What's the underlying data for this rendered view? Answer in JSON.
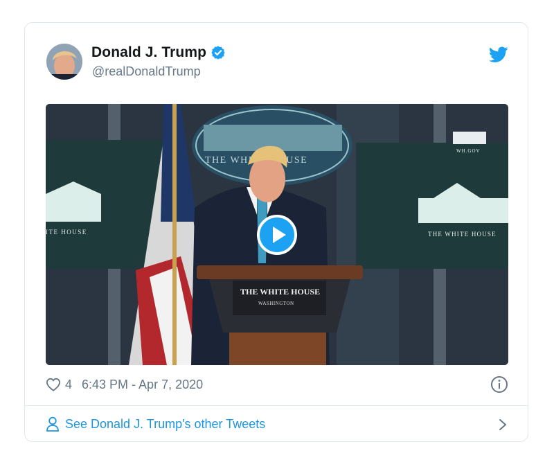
{
  "tweet": {
    "author": {
      "name": "Donald J. Trump",
      "handle": "@realDonaldTrump",
      "verified": true
    },
    "media": {
      "type": "video",
      "podium_sign": {
        "title": "THE WHITE HOUSE",
        "subtitle": "WASHINGTON"
      },
      "left_screen_text": "ITE HOUSE",
      "right_screen_text": "THE WHITE HOUSE",
      "right_screen_corner": "WH.GOV",
      "seal_text": "THE WHITE HOUSE",
      "play_icon": "play-icon"
    },
    "likes": "4",
    "timestamp": "6:43 PM - Apr 7, 2020",
    "footer_link": "See Donald J. Trump's other Tweets"
  },
  "colors": {
    "accent": "#1da1f2",
    "link": "#1b95e0",
    "muted": "#657786",
    "border": "#e1e8ed"
  }
}
